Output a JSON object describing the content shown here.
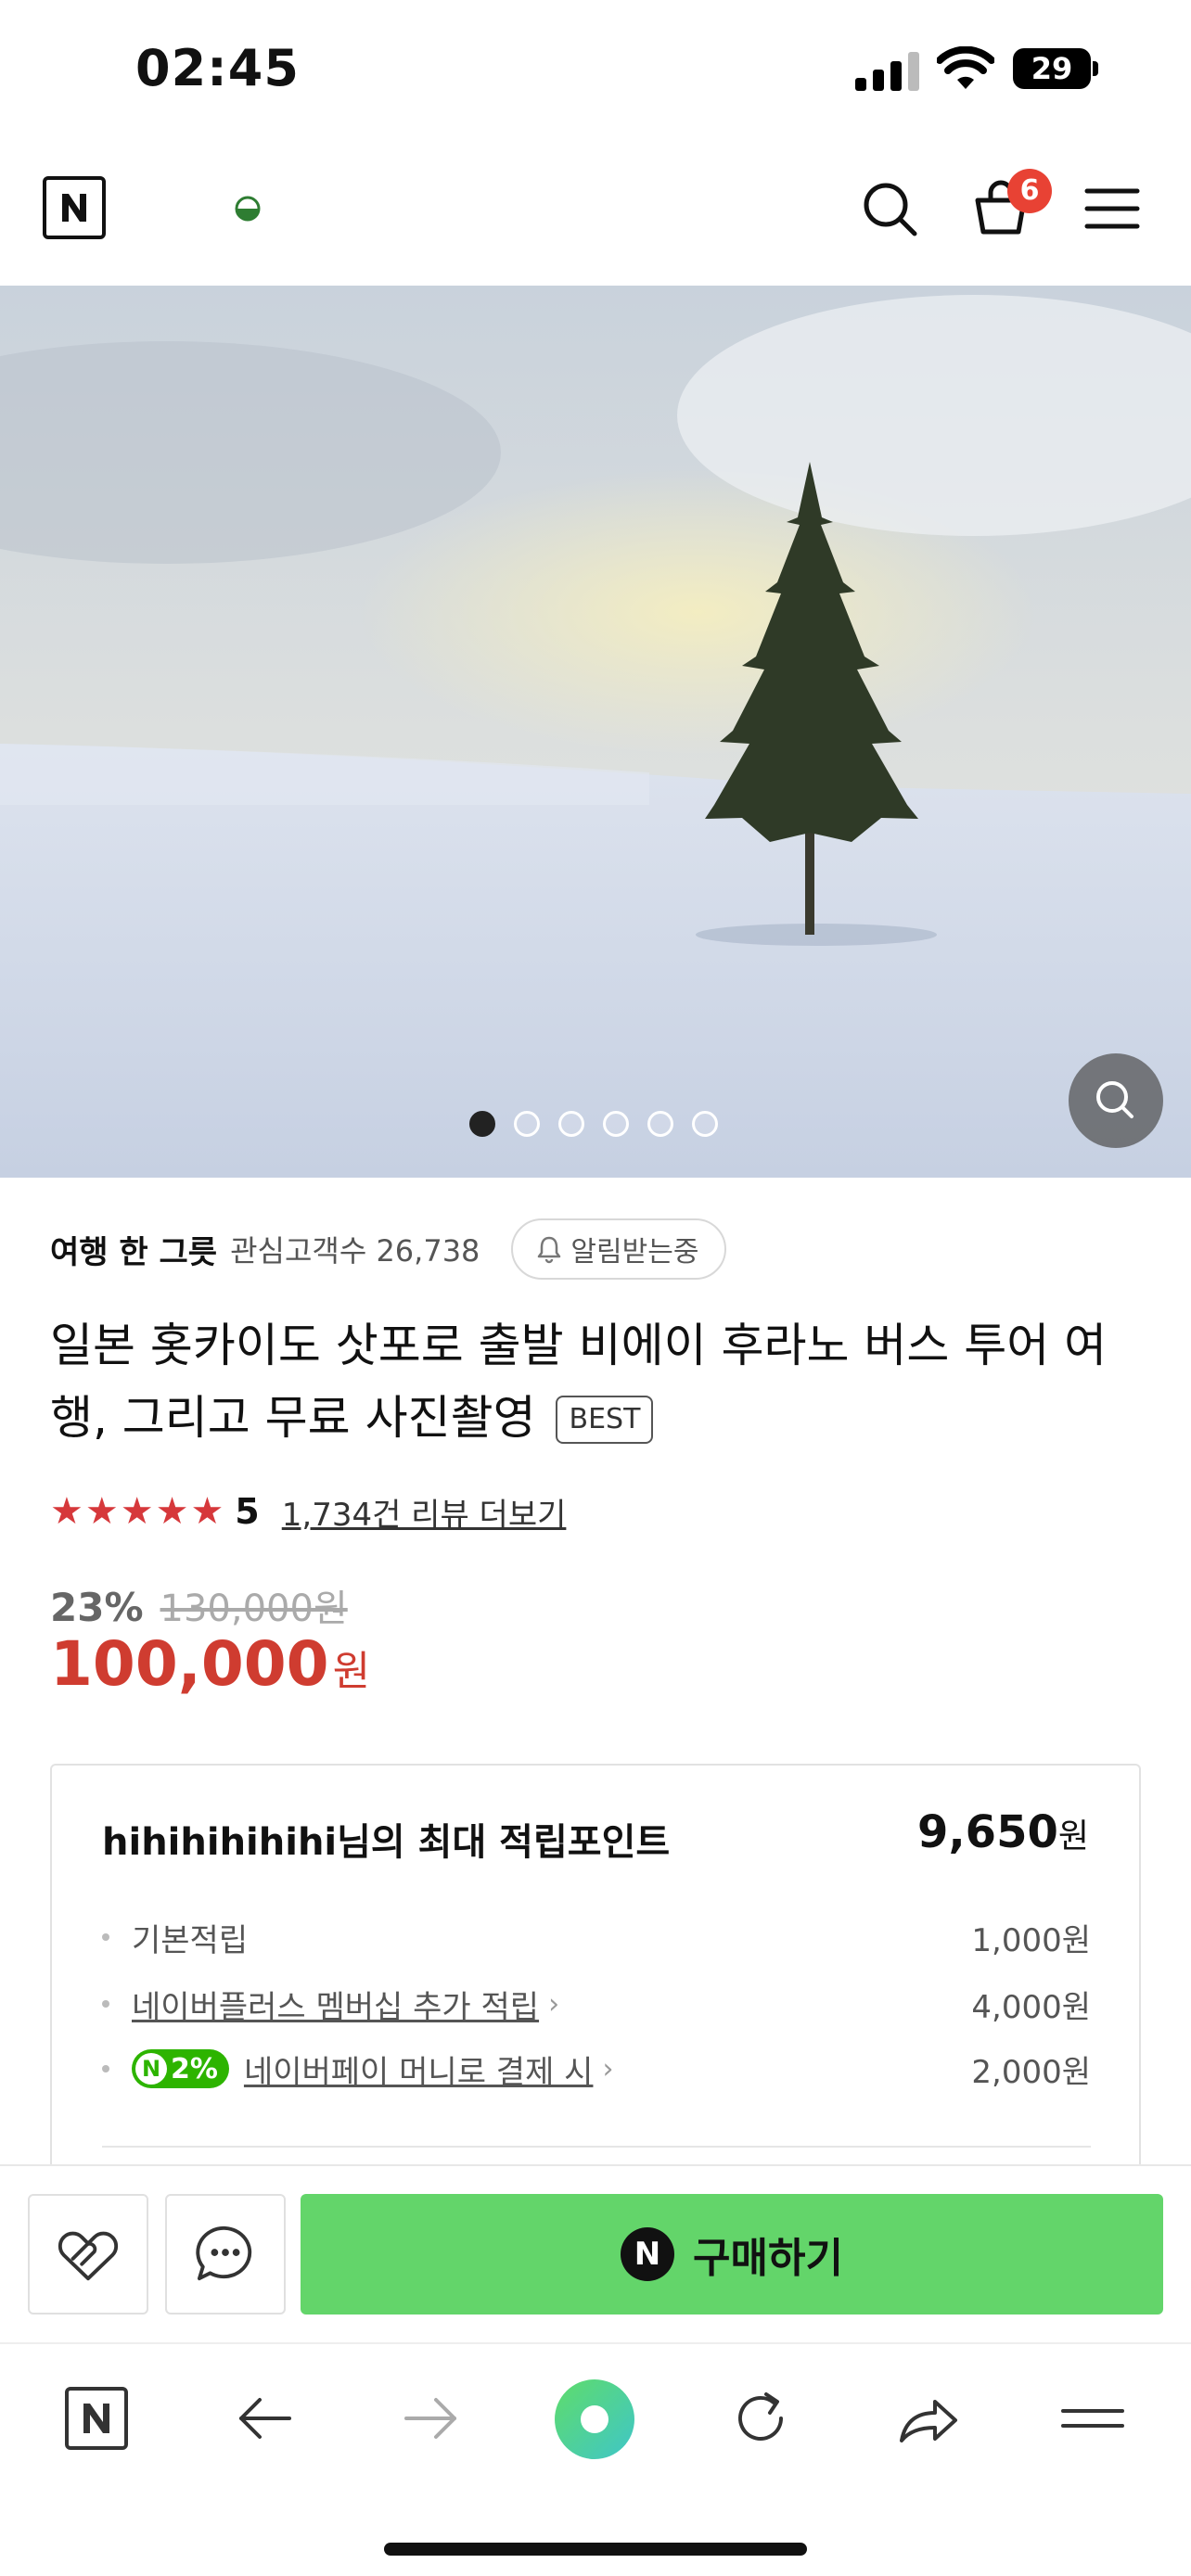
{
  "status_bar": {
    "time": "02:45",
    "battery": "29"
  },
  "header": {
    "logo_letter": "N",
    "cart_count": "6",
    "icons": [
      "naver-logo-icon",
      "half-circle-icon",
      "search-icon",
      "cart-icon",
      "menu-icon"
    ]
  },
  "hero": {
    "image_count": 6,
    "active_index": 0
  },
  "seller": {
    "name": "여행 한 그릇",
    "followers": "관심고객수 26,738",
    "notify_label": "알림받는중"
  },
  "product": {
    "title": "일본 홋카이도 삿포로 출발 비에이 후라노 버스 투어 여행, 그리고 무료 사진촬영",
    "badge": "BEST",
    "stars": "★★★★★",
    "rating": "5",
    "review_link": "1,734건 리뷰 더보기",
    "discount": "23%",
    "original_price": "130,000원",
    "sale_price": "100,000",
    "currency": "원"
  },
  "points": {
    "heading": "hihihihihihi님의 최대 적립포인트",
    "total": "9,650",
    "total_unit": "원",
    "rows": [
      {
        "label": "기본적립",
        "value": "1,000원"
      },
      {
        "label": "네이버플러스 멤버십 추가 적립",
        "value": "4,000원"
      },
      {
        "badge": "2%",
        "label": "네이버페이 머니로 결제 시",
        "value": "2,000원"
      }
    ]
  },
  "buy_bar": {
    "buy_label": "구매하기",
    "npay_letter": "N"
  },
  "browser_bar": {
    "logo_letter": "N"
  },
  "colors": {
    "accent_red": "#cf3c30",
    "buy_green": "#63d56a",
    "npay_green": "#2db400",
    "badge_red": "#e84234"
  }
}
